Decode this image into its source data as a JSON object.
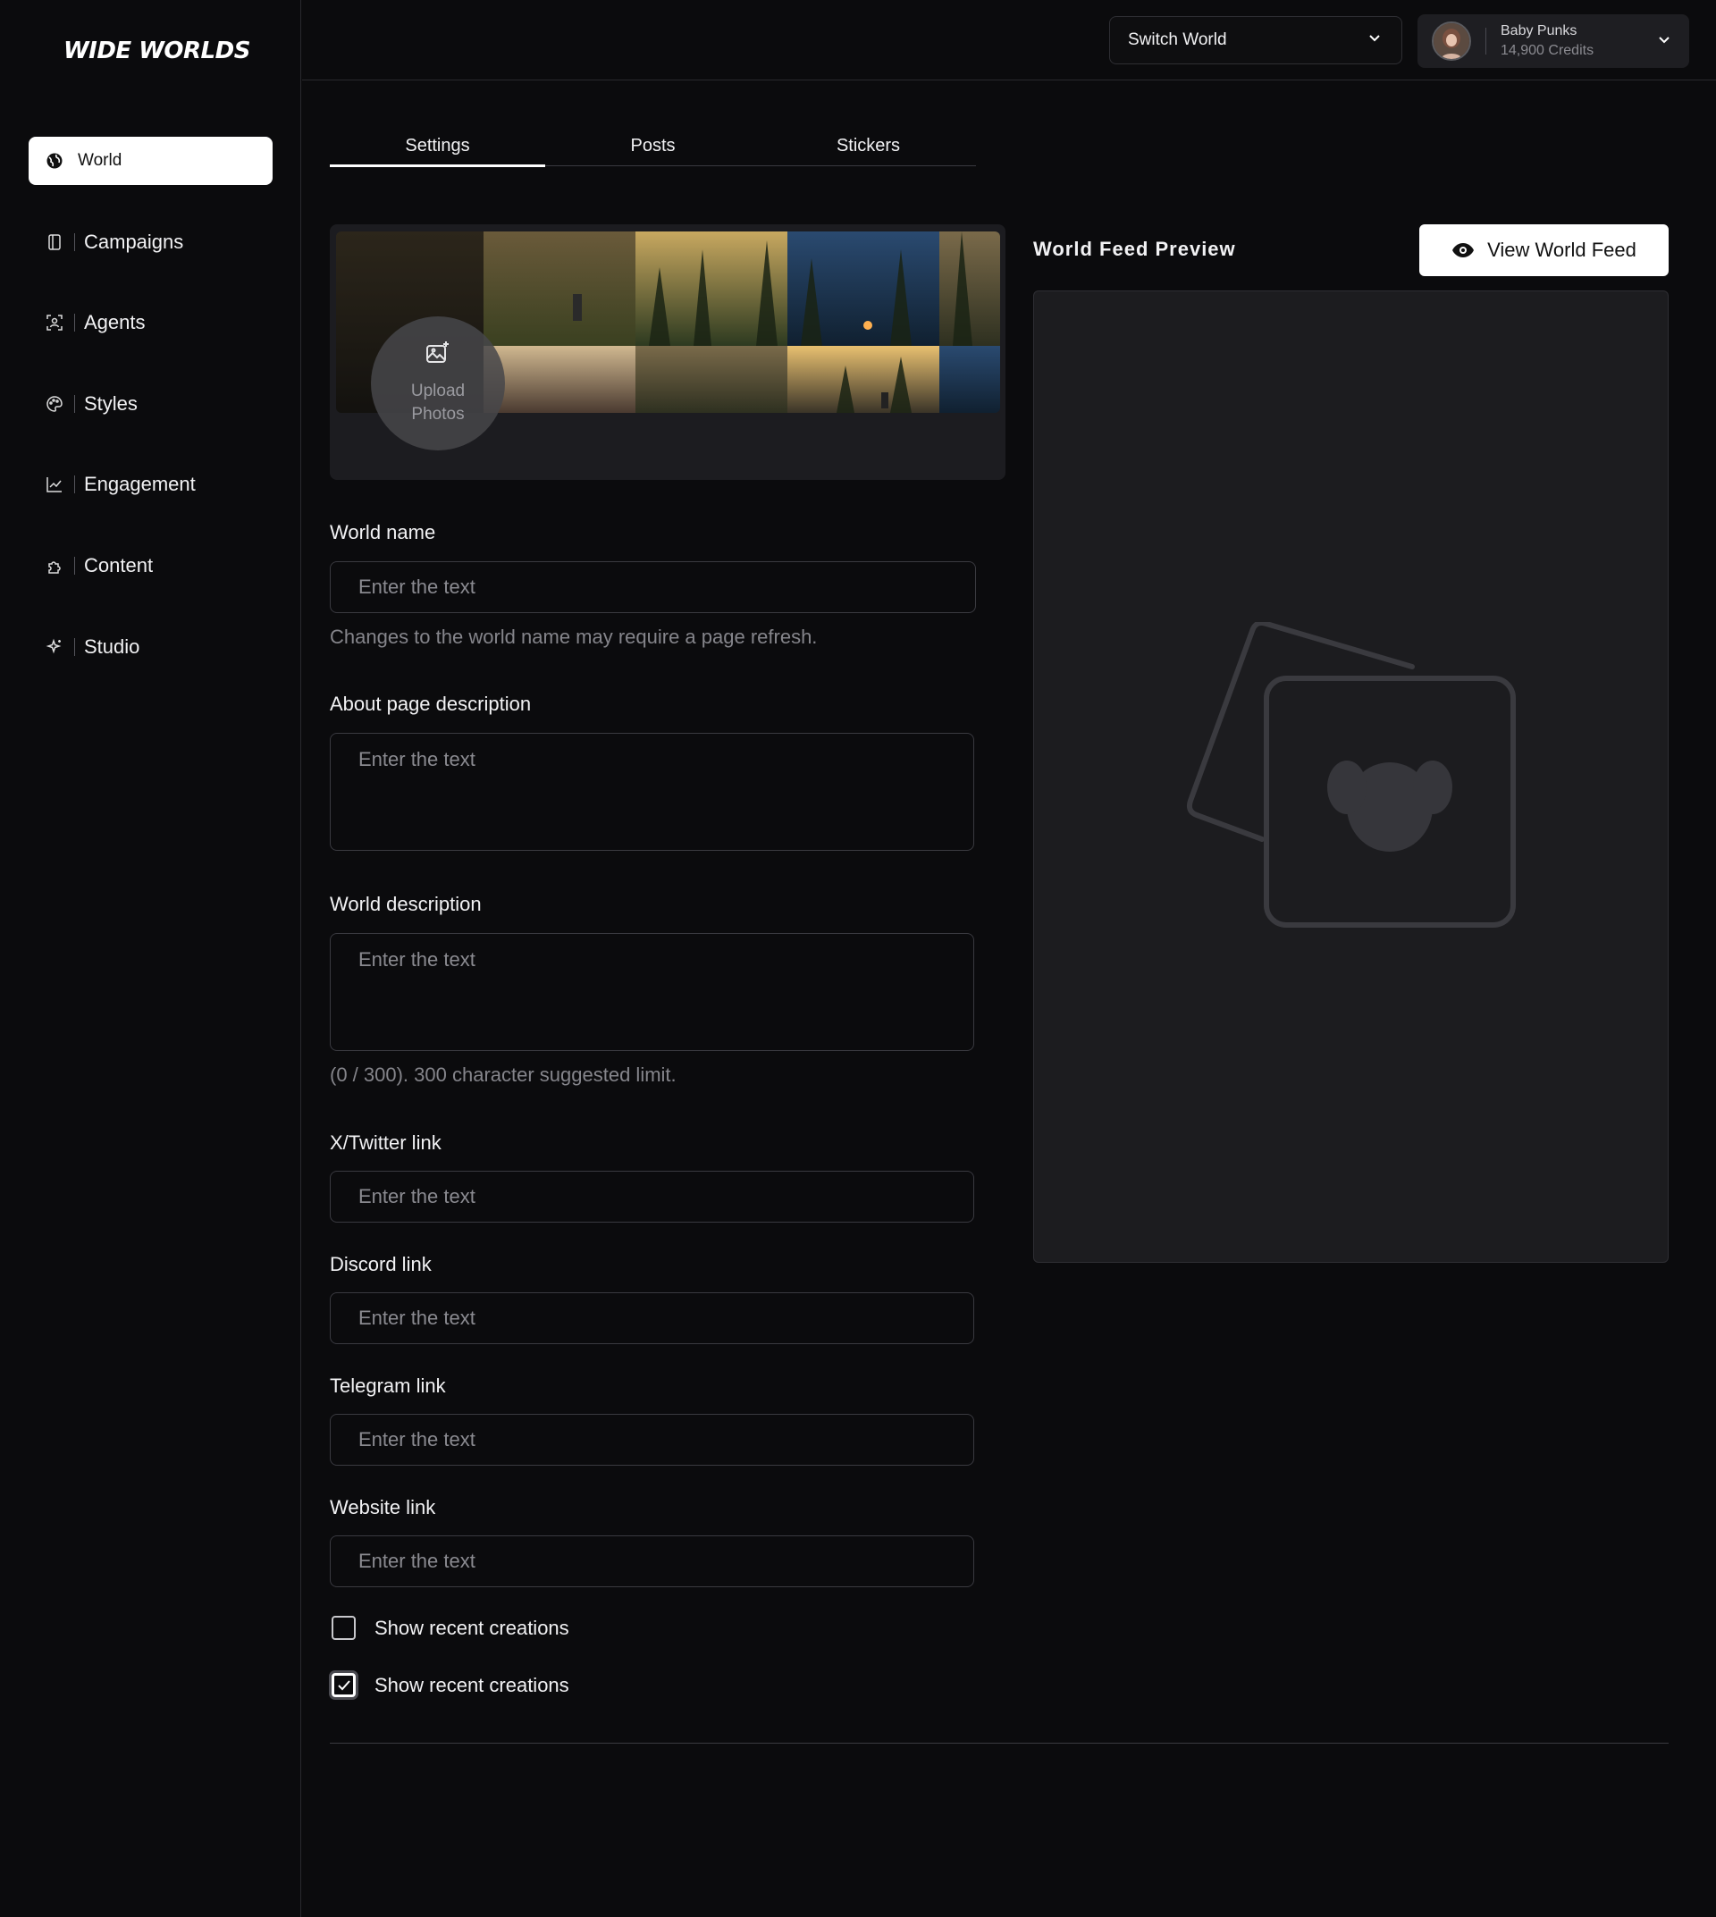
{
  "brand": {
    "logo_text": "WIDE WORLDS"
  },
  "sidebar": {
    "items": [
      {
        "label": "World",
        "icon": "globe-icon",
        "active": true
      },
      {
        "label": "Campaigns",
        "icon": "book-icon",
        "active": false
      },
      {
        "label": "Agents",
        "icon": "agent-scan-icon",
        "active": false
      },
      {
        "label": "Styles",
        "icon": "palette-icon",
        "active": false
      },
      {
        "label": "Engagement",
        "icon": "chart-line-icon",
        "active": false
      },
      {
        "label": "Content",
        "icon": "puzzle-icon",
        "active": false
      },
      {
        "label": "Studio",
        "icon": "sparkle-icon",
        "active": false
      }
    ]
  },
  "header": {
    "switch_world_label": "Switch World",
    "account": {
      "name": "Baby Punks",
      "credits": "14,900 Credits"
    }
  },
  "tabs": [
    {
      "label": "Settings",
      "active": true
    },
    {
      "label": "Posts",
      "active": false
    },
    {
      "label": "Stickers",
      "active": false
    }
  ],
  "upload": {
    "label_line1": "Upload",
    "label_line2": "Photos"
  },
  "form": {
    "world_name": {
      "label": "World name",
      "placeholder": "Enter the text",
      "hint": "Changes to the world name may require a page refresh."
    },
    "about": {
      "label": "About page description",
      "placeholder": "Enter the text"
    },
    "world_description": {
      "label": "World description",
      "placeholder": "Enter the text",
      "hint": "(0 / 300). 300 character suggested limit."
    },
    "twitter": {
      "label": "X/Twitter link",
      "placeholder": "Enter the text"
    },
    "discord": {
      "label": "Discord link",
      "placeholder": "Enter the text"
    },
    "telegram": {
      "label": "Telegram link",
      "placeholder": "Enter the text"
    },
    "website": {
      "label": "Website link",
      "placeholder": "Enter the text"
    },
    "checkboxes": [
      {
        "label": "Show recent creations",
        "checked": false
      },
      {
        "label": "Show recent creations",
        "checked": true
      }
    ]
  },
  "preview": {
    "title": "World Feed Preview",
    "view_button": "View World Feed"
  }
}
